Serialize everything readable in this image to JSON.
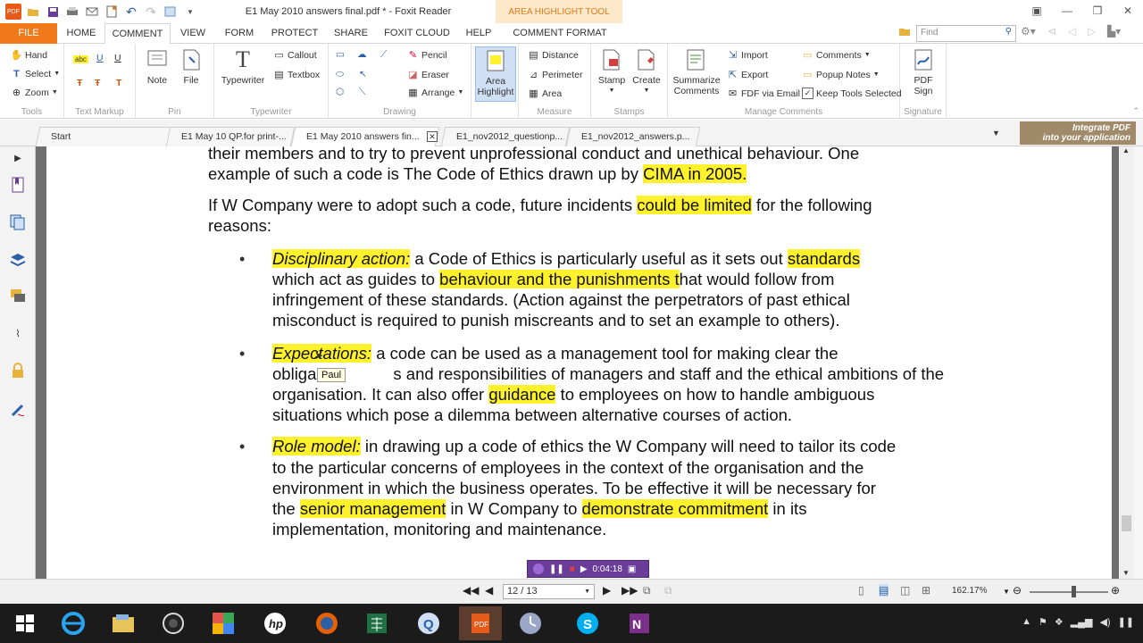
{
  "window": {
    "title": "E1 May 2010 answers final.pdf * - Foxit Reader",
    "context_tab": "AREA HIGHLIGHT TOOL"
  },
  "ribbon_tabs": [
    "FILE",
    "HOME",
    "COMMENT",
    "VIEW",
    "FORM",
    "PROTECT",
    "SHARE",
    "FOXIT CLOUD",
    "HELP",
    "COMMENT FORMAT"
  ],
  "active_tab": "COMMENT",
  "search": {
    "placeholder": "Find"
  },
  "ribbon": {
    "tools": {
      "hand": "Hand",
      "select": "Select",
      "zoom": "Zoom",
      "label": "Tools"
    },
    "text_markup": {
      "label": "Text Markup"
    },
    "pin": {
      "note": "Note",
      "file": "File",
      "label": "Pin"
    },
    "typewriter": {
      "typewriter": "Typewriter",
      "callout": "Callout",
      "textbox": "Textbox",
      "label": "Typewriter"
    },
    "drawing": {
      "pencil": "Pencil",
      "eraser": "Eraser",
      "arrange": "Arrange",
      "label": "Drawing"
    },
    "area_highlight": {
      "text": "Area Highlight"
    },
    "measure": {
      "distance": "Distance",
      "perimeter": "Perimeter",
      "area": "Area",
      "label": "Measure"
    },
    "stamps": {
      "stamp": "Stamp",
      "create": "Create",
      "label": "Stamps"
    },
    "manage": {
      "summarize": "Summarize Comments",
      "import": "Import",
      "export": "Export",
      "fdf": "FDF via Email",
      "comments": "Comments",
      "popup": "Popup Notes",
      "keep": "Keep Tools Selected",
      "label": "Manage Comments"
    },
    "signature": {
      "pdf_sign": "PDF Sign",
      "label": "Signature"
    }
  },
  "doc_tabs": [
    {
      "label": "Start"
    },
    {
      "label": "E1 May 10 QP.for print-..."
    },
    {
      "label": "E1 May 2010 answers fin..."
    },
    {
      "label": "E1_nov2012_questionp..."
    },
    {
      "label": "E1_nov2012_answers.p..."
    }
  ],
  "banner": {
    "line1": "Integrate PDF",
    "line2": "into your application"
  },
  "document": {
    "l1": "their members and to try to prevent unprofessional conduct and unethical behaviour. One",
    "l2a": "example of such a code is  The Code of Ethics drawn up by ",
    "l2b": "CIMA in 2005.",
    "l3a": "If W Company were to adopt such a code, future incidents ",
    "l3b": "could be limited",
    "l3c": " for the following",
    "l4": "reasons:",
    "b1a": "Disciplinary action:",
    "b1b": " a Code of Ethics is particularly useful as it sets out ",
    "b1c": "standards",
    "b1d": "which act as guides to ",
    "b1e": "behaviour and the punishments t",
    "b1f": "hat would follow from",
    "b1g": "infringement of these standards. (Action against the perpetrators of past ethical",
    "b1h": "misconduct is required to punish miscreants and to set an example to others).",
    "b2a": "Expectations:",
    "b2b": " a code can be used as a management tool for making clear the",
    "b2c": "obliga",
    "b2d": "s and responsibilities of managers and staff and the ethical ambitions of the",
    "b2e": "organisation. It can also offer ",
    "b2f": "guidance",
    "b2g": " to employees on how to handle ambiguous",
    "b2h": "situations which pose a dilemma between alternative courses of action.",
    "b3a": "Role model:",
    "b3b": " in drawing up a code of ethics the W Company will need to tailor its code",
    "b3c": "to the particular concerns of employees in the context of the organisation and the",
    "b3d": "environment in which the business operates. To be effective it will be necessary for",
    "b3e": "the ",
    "b3f": "senior management",
    "b3g": " in W Company to ",
    "b3h": "demonstrate commitment",
    "b3i": " in its",
    "b3j": "implementation, monitoring and maintenance.",
    "tooltip": "Paul"
  },
  "recorder": {
    "time": "0:04:18"
  },
  "status": {
    "page": "12 / 13",
    "zoom": "162.17%"
  }
}
